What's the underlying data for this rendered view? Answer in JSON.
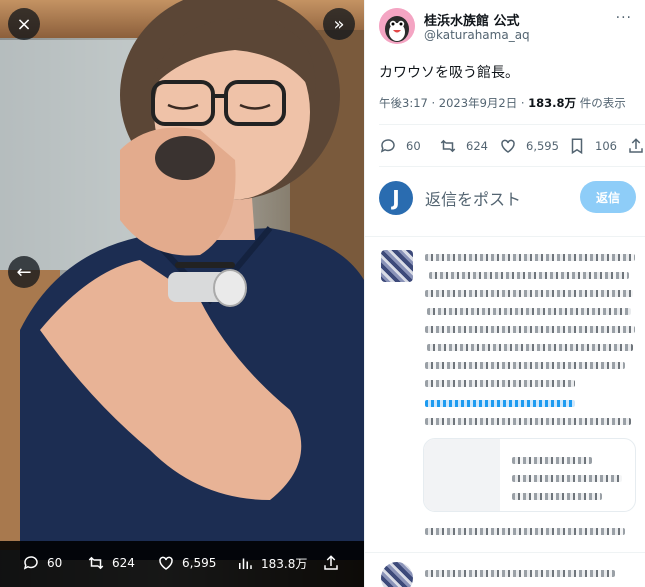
{
  "viewer": {
    "close_icon": "×",
    "expand_icon": "»",
    "prev_icon": "←",
    "bar": {
      "replies": "60",
      "retweets": "624",
      "likes": "6,595",
      "views": "183.8万"
    }
  },
  "tweet": {
    "display_name": "桂浜水族館 公式",
    "handle": "@katurahama_aq",
    "more_icon": "···",
    "text": "カワウソを吸う館長。",
    "time": "午後3:17",
    "dot": "·",
    "date": "2023年9月2日",
    "views_count": "183.8万",
    "views_label": "件の表示",
    "actions": {
      "replies": "60",
      "retweets": "624",
      "likes": "6,595",
      "bookmarks": "106"
    }
  },
  "compose": {
    "avatar_letter": "J",
    "placeholder": "返信をポスト",
    "reply_button": "返信"
  },
  "colors": {
    "accent": "#1d9bf0",
    "reply_button_disabled": "#8ecdf8",
    "text_primary": "#0f1419",
    "text_secondary": "#536471"
  }
}
